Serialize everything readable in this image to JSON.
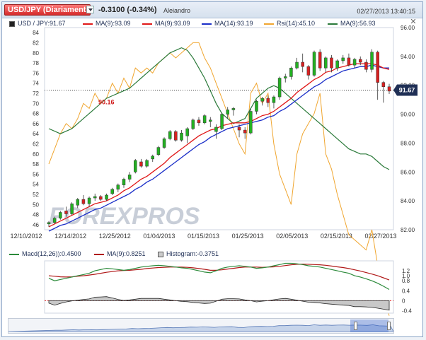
{
  "header": {
    "pair_tab": "USD/JPY (Diariamente)",
    "change": "-0.3100 (-0.34%)",
    "author": "Aleiandro",
    "datetime": "02/27/2013 13:40:15"
  },
  "legend": {
    "price": "USD / JPY:91.67",
    "ma1": "MA(9):93.09",
    "ma2": "MA(9):93.09",
    "ma3": "MA(14):93.19",
    "rsi": "Rsi(14):45.10",
    "ma4": "MA(9):56.93"
  },
  "macd_legend": {
    "macd": "Macd(12,26)):0.4500",
    "ma": "MA(9):0.8251",
    "hist": "Histogram:-0.3751"
  },
  "colors": {
    "up": "#22b021",
    "down": "#d92020",
    "ma_red": "#e01818",
    "ma_blue": "#1a2ec8",
    "rsi": "#f0a630",
    "ma_green": "#2b7a3a",
    "macd": "#2b8a3a",
    "signal": "#b01818"
  },
  "watermark": "FOREXPROS",
  "chart_data": {
    "type": "candlestick",
    "x_dates": [
      "12/10/2012",
      "12/14/2012",
      "12/25/2012",
      "01/04/2013",
      "01/15/2013",
      "01/25/2013",
      "02/05/2013",
      "02/15/2013",
      "02/27/2013"
    ],
    "right_axis": {
      "ticks": [
        "96.00",
        "94.00",
        "92.00",
        "90.00",
        "88.00",
        "86.00",
        "84.00",
        "82.00"
      ],
      "range": [
        82,
        96
      ]
    },
    "left_axis": {
      "ticks": [
        "84",
        "82",
        "80",
        "78",
        "76",
        "74",
        "72",
        "70",
        "68",
        "66",
        "64",
        "62",
        "60",
        "58",
        "56",
        "54",
        "52",
        "50",
        "48",
        "46"
      ],
      "range": [
        45,
        85
      ]
    },
    "last_price_label": "91.67",
    "annotation": "90.16",
    "candles": [
      [
        82.4,
        82.6,
        82.2,
        82.5
      ],
      [
        82.5,
        82.9,
        82.4,
        82.8
      ],
      [
        82.8,
        83.3,
        82.7,
        83.2
      ],
      [
        83.3,
        83.6,
        82.9,
        83.1
      ],
      [
        83.1,
        83.9,
        83.0,
        83.8
      ],
      [
        83.7,
        84.2,
        83.5,
        84.1
      ],
      [
        84.1,
        84.4,
        83.7,
        83.8
      ],
      [
        83.8,
        84.3,
        83.6,
        84.2
      ],
      [
        84.2,
        84.5,
        84.0,
        84.3
      ],
      [
        84.3,
        84.4,
        84.0,
        84.1
      ],
      [
        84.1,
        84.5,
        84.0,
        84.4
      ],
      [
        84.5,
        84.9,
        84.4,
        84.8
      ],
      [
        84.8,
        85.2,
        84.6,
        85.1
      ],
      [
        85.1,
        85.6,
        84.9,
        85.5
      ],
      [
        85.5,
        86.0,
        85.3,
        85.8
      ],
      [
        86.0,
        86.9,
        85.9,
        86.8
      ],
      [
        86.7,
        86.9,
        86.3,
        86.4
      ],
      [
        86.4,
        86.9,
        86.3,
        86.8
      ],
      [
        86.9,
        87.2,
        86.7,
        87.1
      ],
      [
        87.2,
        87.8,
        87.1,
        87.7
      ],
      [
        87.7,
        88.4,
        87.6,
        88.3
      ],
      [
        88.3,
        88.9,
        88.2,
        88.8
      ],
      [
        88.8,
        88.9,
        88.1,
        88.2
      ],
      [
        88.2,
        88.9,
        88.1,
        88.7
      ],
      [
        88.5,
        89.1,
        88.0,
        89.0
      ],
      [
        89.0,
        89.7,
        88.9,
        89.6
      ],
      [
        89.6,
        89.8,
        89.2,
        89.4
      ],
      [
        89.4,
        90.0,
        89.3,
        89.9
      ],
      [
        89.5,
        89.8,
        89.1,
        89.6
      ],
      [
        88.8,
        89.3,
        88.3,
        89.1
      ],
      [
        89.0,
        90.1,
        88.9,
        90.0
      ],
      [
        90.0,
        90.5,
        89.7,
        90.3
      ],
      [
        90.3,
        90.5,
        89.9,
        90.4
      ],
      [
        89.1,
        89.3,
        88.4,
        88.9
      ],
      [
        88.9,
        89.1,
        88.3,
        88.7
      ],
      [
        88.7,
        90.4,
        88.6,
        90.2
      ],
      [
        90.2,
        91.0,
        90.0,
        90.9
      ],
      [
        90.9,
        91.2,
        90.6,
        91.1
      ],
      [
        91.1,
        91.3,
        90.5,
        90.8
      ],
      [
        90.8,
        91.3,
        90.4,
        91.2
      ],
      [
        91.2,
        92.6,
        91.0,
        92.5
      ],
      [
        92.5,
        92.8,
        92.2,
        92.6
      ],
      [
        92.6,
        93.3,
        92.4,
        93.2
      ],
      [
        93.2,
        93.9,
        93.1,
        93.6
      ],
      [
        93.6,
        94.2,
        92.9,
        93.3
      ],
      [
        93.3,
        93.4,
        92.4,
        92.7
      ],
      [
        92.7,
        94.4,
        92.6,
        94.3
      ],
      [
        94.3,
        94.5,
        93.0,
        93.2
      ],
      [
        93.2,
        94.0,
        92.9,
        93.9
      ],
      [
        93.9,
        94.1,
        92.9,
        93.2
      ],
      [
        93.2,
        93.8,
        93.0,
        93.7
      ],
      [
        93.7,
        94.1,
        93.5,
        93.9
      ],
      [
        93.9,
        94.2,
        93.3,
        93.4
      ],
      [
        93.4,
        93.9,
        93.2,
        93.8
      ],
      [
        93.8,
        94.0,
        93.4,
        93.6
      ],
      [
        93.6,
        93.8,
        92.9,
        93.1
      ],
      [
        93.1,
        94.5,
        92.9,
        94.3
      ],
      [
        94.3,
        94.4,
        91.0,
        92.2
      ],
      [
        92.2,
        92.3,
        90.8,
        91.9
      ],
      [
        91.9,
        92.1,
        91.4,
        91.6
      ]
    ],
    "ma9_red": [
      82.2,
      82.4,
      82.6,
      82.8,
      83.0,
      83.2,
      83.4,
      83.6,
      83.8,
      83.9,
      84.0,
      84.2,
      84.4,
      84.7,
      84.9,
      85.2,
      85.5,
      85.7,
      86.0,
      86.3,
      86.6,
      87.0,
      87.3,
      87.6,
      87.9,
      88.2,
      88.5,
      88.7,
      88.9,
      89.0,
      89.2,
      89.3,
      89.4,
      89.4,
      89.4,
      89.5,
      89.7,
      89.9,
      90.0,
      90.2,
      90.5,
      90.8,
      91.1,
      91.5,
      91.8,
      92.1,
      92.4,
      92.6,
      92.9,
      93.0,
      93.2,
      93.3,
      93.4,
      93.5,
      93.5,
      93.5,
      93.5,
      93.4,
      93.2,
      93.1
    ],
    "ma14_blue": [
      81.9,
      82.1,
      82.3,
      82.4,
      82.6,
      82.8,
      83.0,
      83.2,
      83.4,
      83.5,
      83.7,
      83.9,
      84.1,
      84.3,
      84.5,
      84.8,
      85.0,
      85.3,
      85.5,
      85.8,
      86.1,
      86.4,
      86.7,
      87.0,
      87.3,
      87.6,
      87.9,
      88.1,
      88.4,
      88.6,
      88.8,
      89.0,
      89.1,
      89.2,
      89.3,
      89.4,
      89.5,
      89.6,
      89.8,
      89.9,
      90.2,
      90.4,
      90.7,
      91.0,
      91.3,
      91.6,
      91.9,
      92.1,
      92.4,
      92.6,
      92.8,
      93.0,
      93.1,
      93.2,
      93.3,
      93.3,
      93.4,
      93.3,
      93.2,
      93.2
    ],
    "rsi": [
      58,
      61,
      64,
      66,
      65,
      67,
      70,
      69,
      72,
      70,
      71,
      74,
      72,
      75,
      73,
      77,
      76,
      77,
      76,
      78,
      79,
      80,
      79,
      80,
      81,
      82,
      82,
      79,
      77,
      74,
      71,
      68,
      65,
      62,
      60,
      72,
      74,
      70,
      72,
      62,
      56,
      53,
      50,
      60,
      64,
      66,
      68,
      72,
      60,
      57,
      52,
      48,
      44,
      43,
      42,
      41,
      45,
      38,
      32,
      28
    ],
    "ma9_green": [
      65,
      64.5,
      64,
      64.5,
      65,
      66,
      67,
      68,
      69,
      70,
      71,
      71.5,
      72,
      72.5,
      73,
      74,
      75,
      76,
      77,
      78,
      79,
      80,
      80.5,
      81,
      80.5,
      79,
      77,
      75,
      72.5,
      70,
      68,
      67,
      66,
      66.5,
      67,
      69,
      71,
      72,
      73,
      73.5,
      73,
      72,
      71,
      70,
      69,
      68,
      67,
      66,
      65,
      64,
      63,
      62,
      61,
      60.5,
      60,
      60,
      59.5,
      58.5,
      57.5,
      56.9
    ],
    "macd": [
      0.9,
      0.8,
      0.85,
      0.9,
      0.95,
      1.0,
      1.05,
      1.1,
      1.2,
      1.25,
      1.3,
      1.28,
      1.25,
      1.22,
      1.25,
      1.3,
      1.35,
      1.38,
      1.4,
      1.42,
      1.4,
      1.38,
      1.35,
      1.32,
      1.3,
      1.25,
      1.2,
      1.15,
      1.12,
      1.2,
      1.3,
      1.35,
      1.38,
      1.4,
      1.38,
      1.35,
      1.3,
      1.32,
      1.35,
      1.4,
      1.45,
      1.5,
      1.5,
      1.48,
      1.45,
      1.4,
      1.38,
      1.35,
      1.3,
      1.25,
      1.2,
      1.15,
      1.1,
      1.0,
      0.95,
      0.88,
      0.8,
      0.7,
      0.58,
      0.45
    ],
    "signal": [
      1.0,
      0.98,
      0.96,
      0.95,
      0.96,
      0.98,
      1.0,
      1.03,
      1.06,
      1.1,
      1.14,
      1.17,
      1.2,
      1.21,
      1.22,
      1.24,
      1.26,
      1.29,
      1.31,
      1.33,
      1.34,
      1.35,
      1.35,
      1.35,
      1.34,
      1.32,
      1.29,
      1.26,
      1.22,
      1.22,
      1.24,
      1.27,
      1.3,
      1.33,
      1.35,
      1.35,
      1.35,
      1.34,
      1.35,
      1.36,
      1.38,
      1.41,
      1.44,
      1.46,
      1.47,
      1.46,
      1.45,
      1.44,
      1.42,
      1.39,
      1.36,
      1.33,
      1.29,
      1.24,
      1.19,
      1.13,
      1.07,
      1.0,
      0.92,
      0.83
    ],
    "macd_axis": {
      "ticks": [
        "1.2",
        "1.0",
        "0.8",
        "0.4",
        "0",
        "-0.4"
      ],
      "range": [
        -0.5,
        1.6
      ]
    }
  }
}
